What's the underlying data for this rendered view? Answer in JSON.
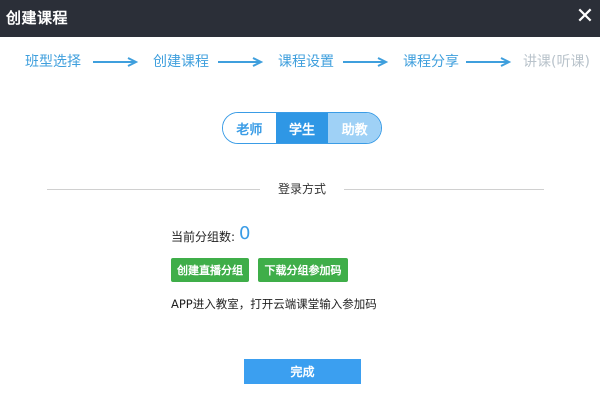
{
  "window": {
    "title": "创建课程"
  },
  "steps": [
    "班型选择",
    "创建课程",
    "课程设置",
    "课程分享",
    "讲课(听课)"
  ],
  "roles": {
    "teacher": "老师",
    "student": "学生",
    "assistant": "助教"
  },
  "section": {
    "title": "登录方式"
  },
  "groups": {
    "count_label": "当前分组数:",
    "count_value": "0"
  },
  "buttons": {
    "create_group": "创建直播分组",
    "download_code": "下载分组参加码",
    "done": "完成"
  },
  "hint": "APP进入教室，打开云端课堂输入参加码",
  "colors": {
    "accent": "#3a9ce6",
    "green": "#3fae49",
    "titlebar": "#2b2f38",
    "disabled": "#b9c3cb"
  }
}
